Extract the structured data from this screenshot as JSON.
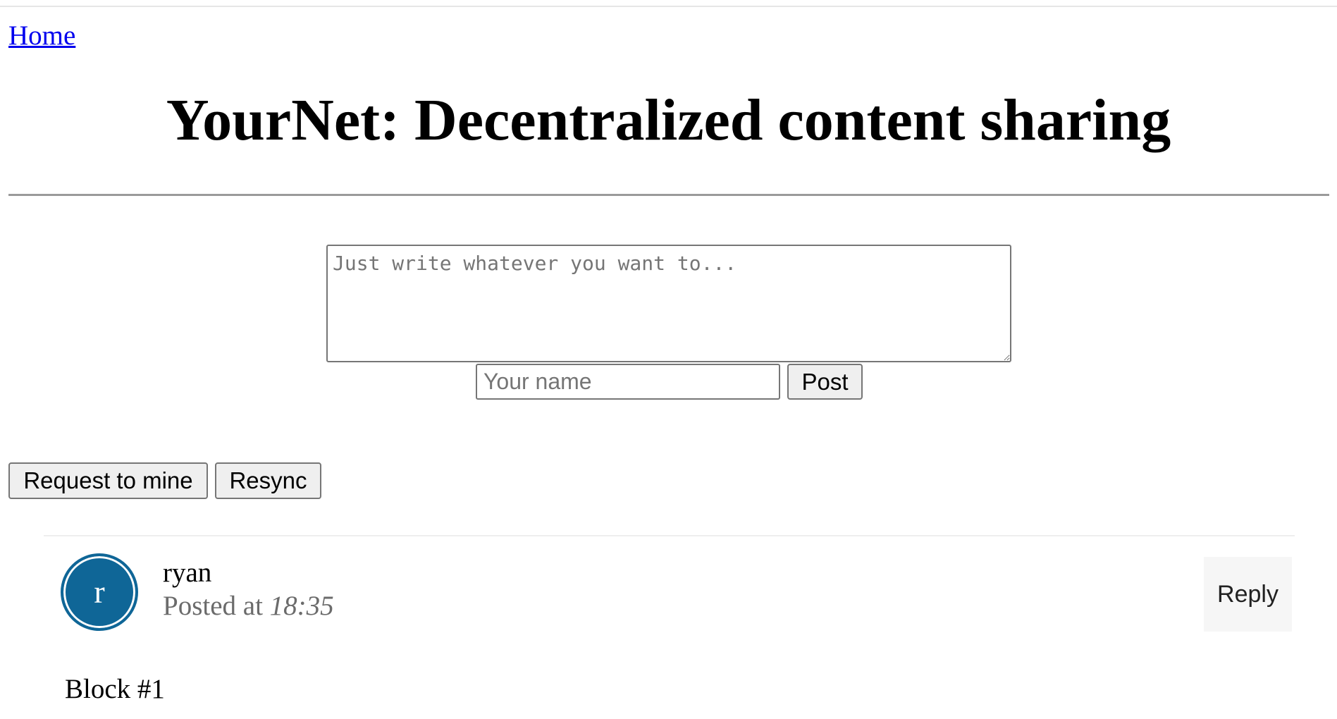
{
  "nav": {
    "home_label": "Home"
  },
  "header": {
    "title": "YourNet: Decentralized content sharing"
  },
  "composer": {
    "textarea_placeholder": "Just write whatever you want to...",
    "textarea_value": "",
    "name_placeholder": "Your name",
    "name_value": "",
    "post_label": "Post"
  },
  "actions": {
    "mine_label": "Request to mine",
    "resync_label": "Resync"
  },
  "posts": [
    {
      "avatar_letter": "r",
      "author": "ryan",
      "posted_prefix": "Posted at",
      "time": "18:35",
      "reply_label": "Reply",
      "body": "Block #1"
    }
  ],
  "colors": {
    "link": "#0000ee",
    "avatar": "#0f6697",
    "meta_text": "#6b6b6b",
    "reply_bg": "#f6f6f6"
  },
  "icons": {
    "resize_handle": "textarea-resize-icon"
  }
}
